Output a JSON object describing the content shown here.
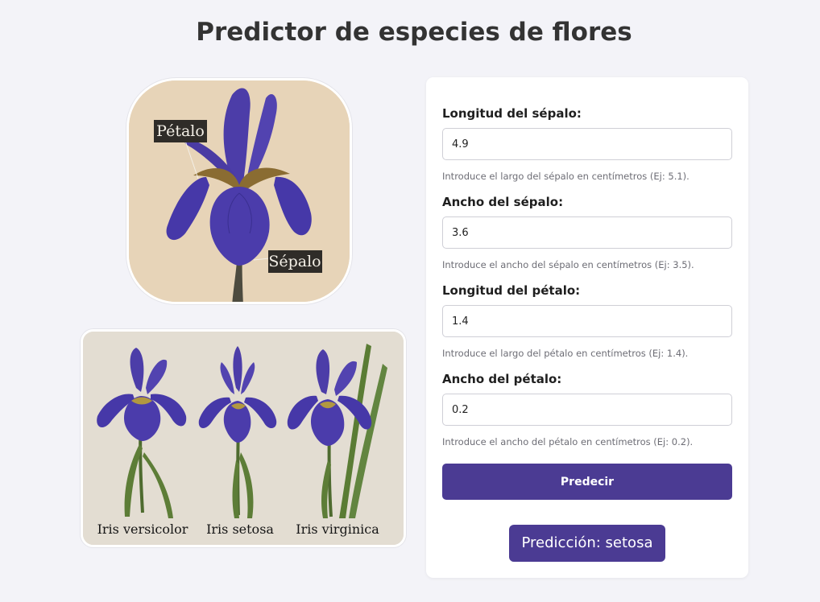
{
  "page": {
    "title": "Predictor de especies de flores"
  },
  "diagram": {
    "petal_label": "Pétalo",
    "sepal_label": "Sépalo"
  },
  "species": {
    "names": [
      "Iris versicolor",
      "Iris setosa",
      "Iris virginica"
    ]
  },
  "form": {
    "fields": [
      {
        "label": "Longitud del sépalo:",
        "value": "4.9",
        "help": "Introduce el largo del sépalo en centímetros (Ej: 5.1)."
      },
      {
        "label": "Ancho del sépalo:",
        "value": "3.6",
        "help": "Introduce el ancho del sépalo en centímetros (Ej: 3.5)."
      },
      {
        "label": "Longitud del pétalo:",
        "value": "1.4",
        "help": "Introduce el largo del pétalo en centímetros (Ej: 1.4)."
      },
      {
        "label": "Ancho del pétalo:",
        "value": "0.2",
        "help": "Introduce el ancho del pétalo en centímetros (Ej: 0.2)."
      }
    ],
    "submit_label": "Predecir"
  },
  "result": {
    "text": "Predicción: setosa"
  },
  "colors": {
    "accent": "#4b3b93",
    "background": "#f3f3f8",
    "petal": "#4a3ca8",
    "stem": "#4e6b2f"
  }
}
